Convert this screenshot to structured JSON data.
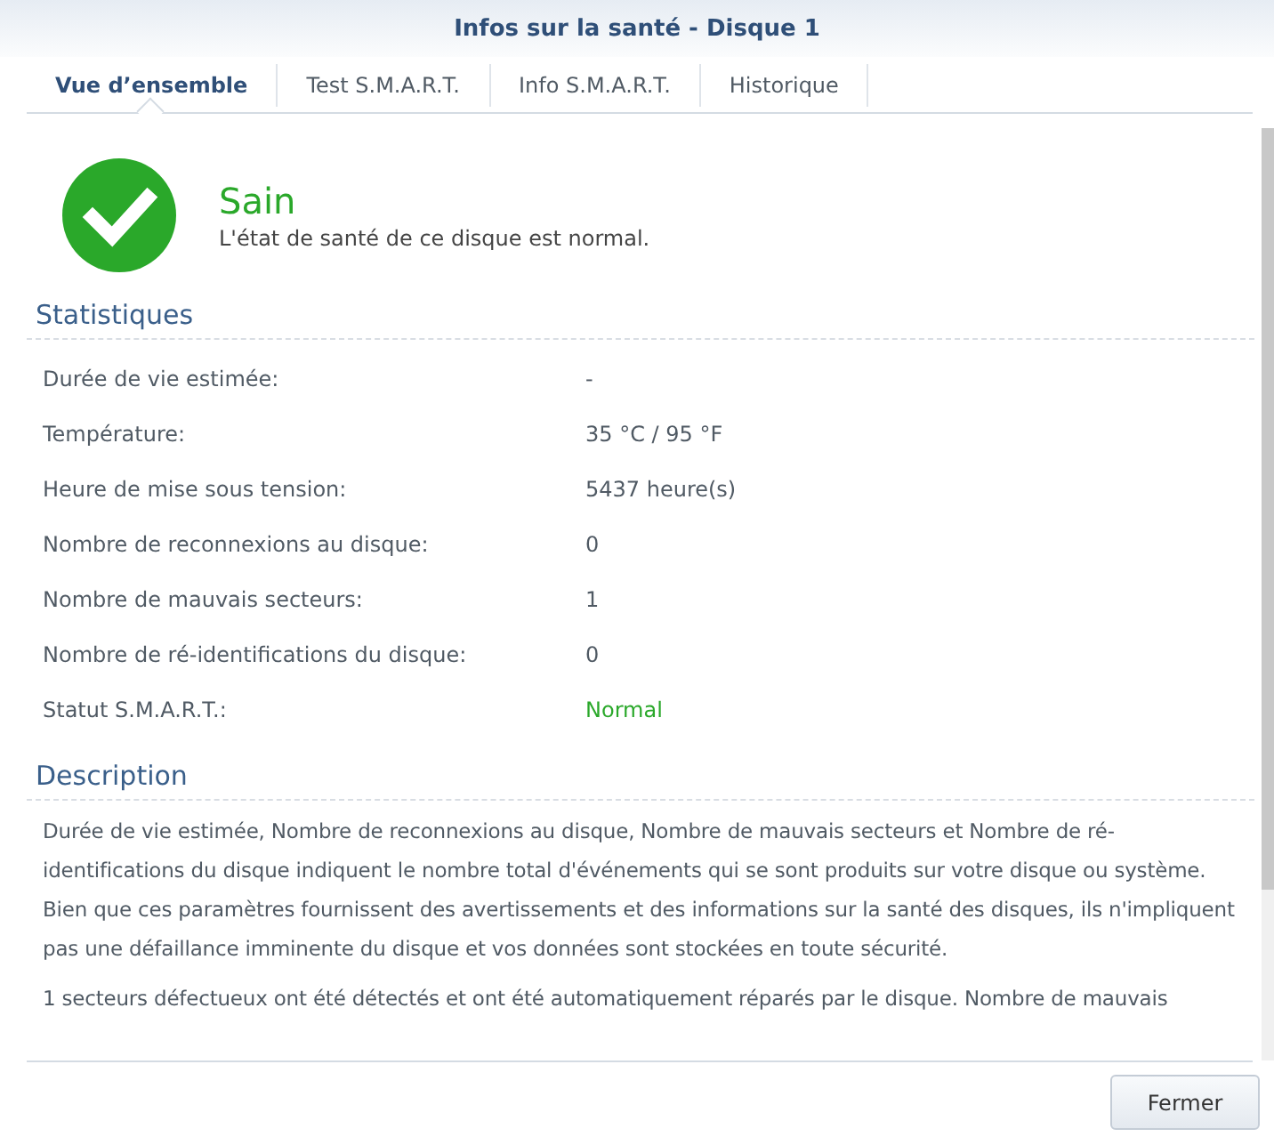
{
  "window": {
    "title": "Infos sur la santé - Disque 1"
  },
  "tabs": [
    {
      "label": "Vue d’ensemble",
      "selected": true
    },
    {
      "label": "Test S.M.A.R.T.",
      "selected": false
    },
    {
      "label": "Info S.M.A.R.T.",
      "selected": false
    },
    {
      "label": "Historique",
      "selected": false
    }
  ],
  "status": {
    "kind": "healthy",
    "title": "Sain",
    "message": "L'état de santé de ce disque est normal."
  },
  "statistics": {
    "heading": "Statistiques",
    "rows": [
      {
        "label": "Durée de vie estimée:",
        "value": "-",
        "kind": "plain"
      },
      {
        "label": "Température:",
        "value": "35 °C / 95 °F",
        "kind": "plain"
      },
      {
        "label": "Heure de mise sous tension:",
        "value": "5437 heure(s)",
        "kind": "plain"
      },
      {
        "label": "Nombre de reconnexions au disque:",
        "value": "0",
        "kind": "plain"
      },
      {
        "label": "Nombre de mauvais secteurs:",
        "value": "1",
        "kind": "plain"
      },
      {
        "label": "Nombre de ré-identifications du disque:",
        "value": "0",
        "kind": "plain"
      },
      {
        "label": "Statut S.M.A.R.T.:",
        "value": "Normal",
        "kind": "good"
      }
    ]
  },
  "description": {
    "heading": "Description",
    "paragraphs": [
      "Durée de vie estimée, Nombre de reconnexions au disque, Nombre de mauvais secteurs et Nombre de ré-identifications du disque indiquent le nombre total d'événements qui se sont produits sur votre disque ou système. Bien que ces paramètres fournissent des avertissements et des informations sur la santé des disques, ils n'impliquent pas une défaillance imminente du disque et vos données sont stockées en toute sécurité.",
      "1 secteurs défectueux ont été détectés et ont été automatiquement réparés par le disque. Nombre de mauvais"
    ]
  },
  "buttons": [
    "Fermer"
  ]
}
